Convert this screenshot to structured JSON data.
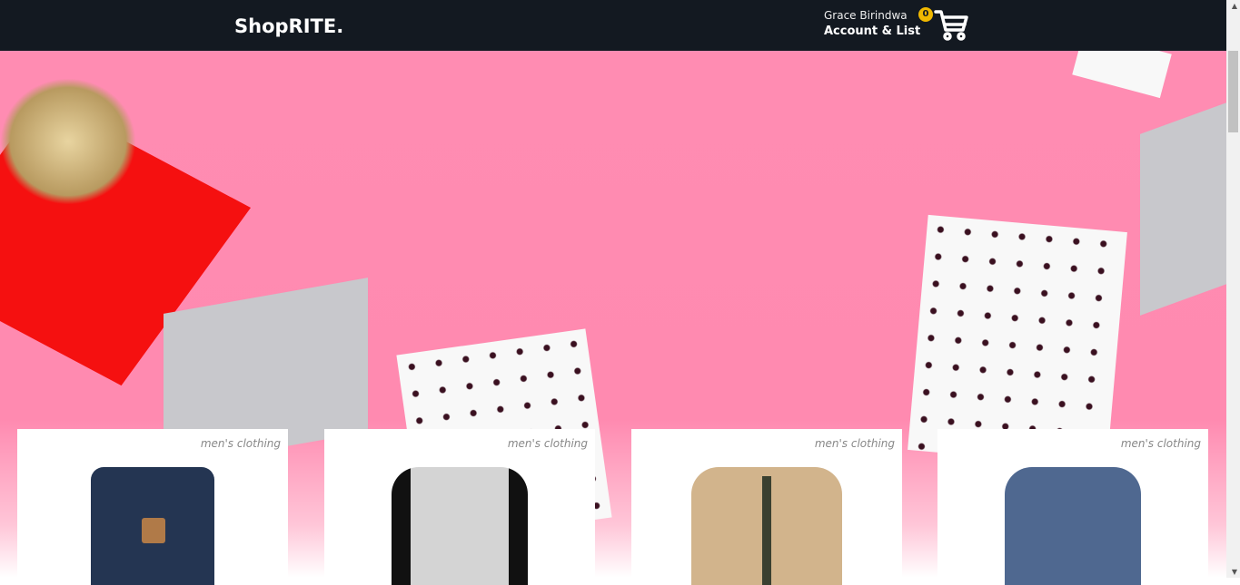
{
  "header": {
    "logo": "ShopRITE.",
    "user_name": "Grace Birindwa",
    "account_label": "Account & List",
    "cart_count": "0",
    "icons": {
      "cart": "cart-icon"
    }
  },
  "colors": {
    "nav": "#131921",
    "badge": "#f0b800",
    "banner": "#ff8ab0"
  },
  "products": [
    {
      "category": "men's clothing",
      "image": "backpack"
    },
    {
      "category": "men's clothing",
      "image": "henley-shirt"
    },
    {
      "category": "men's clothing",
      "image": "cotton-jacket"
    },
    {
      "category": "men's clothing",
      "image": "slim-fit-shirt"
    }
  ]
}
